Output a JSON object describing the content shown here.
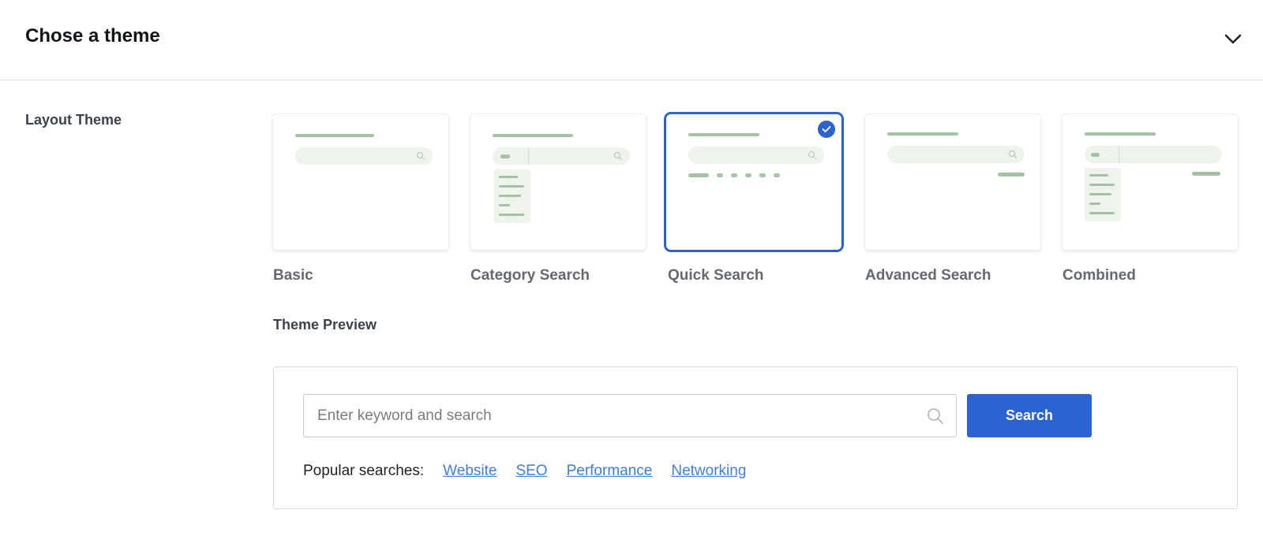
{
  "header": {
    "title": "Chose a theme",
    "collapse_icon": "chevron-down-icon"
  },
  "layout": {
    "label": "Layout Theme",
    "themes": [
      {
        "name": "Basic",
        "selected": false
      },
      {
        "name": "Category Search",
        "selected": false
      },
      {
        "name": "Quick Search",
        "selected": true
      },
      {
        "name": "Advanced Search",
        "selected": false
      },
      {
        "name": "Combined",
        "selected": false
      }
    ]
  },
  "preview": {
    "title": "Theme Preview",
    "search_placeholder": "Enter keyword and search",
    "search_value": "",
    "search_button": "Search",
    "popular_label": "Popular searches:",
    "popular_links": [
      "Website",
      "SEO",
      "Performance",
      "Networking"
    ]
  },
  "colors": {
    "accent": "#2b63d3",
    "link": "#3f7fd6",
    "thumb_green": "#a4c3a3",
    "thumb_fill": "#eef3ec"
  }
}
